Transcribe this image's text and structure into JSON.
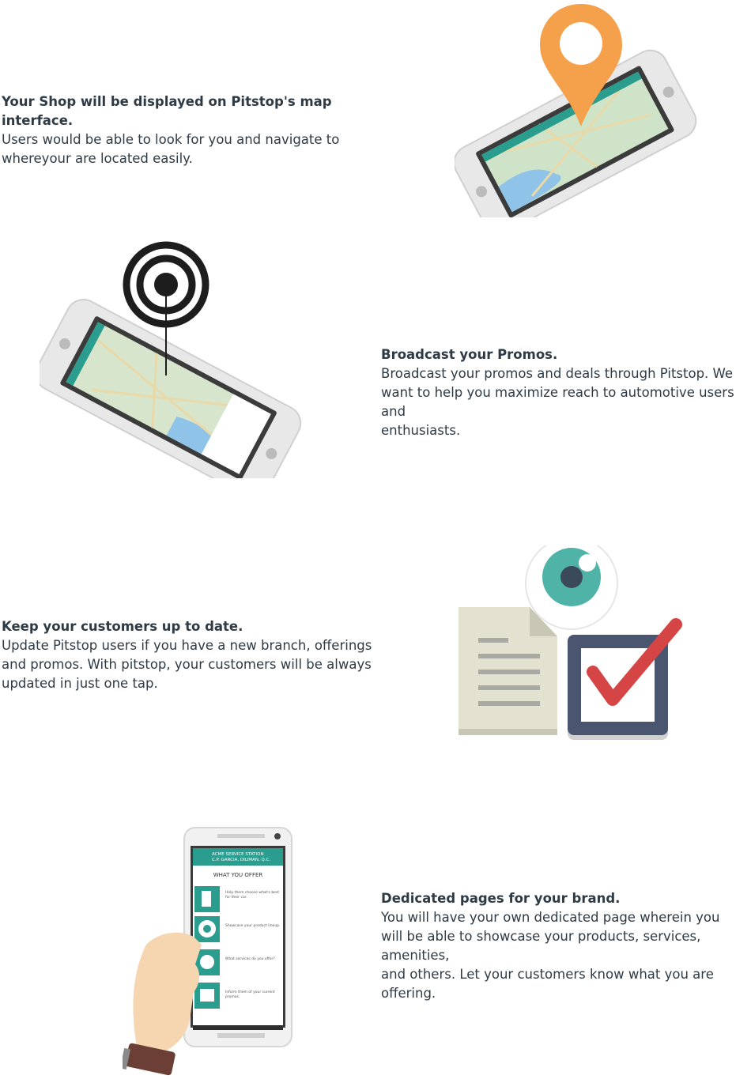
{
  "features": [
    {
      "heading": "Your Shop will be displayed on Pitstop's map interface.",
      "lines": [
        "Users would be able to look for you and navigate to",
        "whereyour are located easily."
      ],
      "illustration": "phone-map-pin-illustration"
    },
    {
      "heading": "Broadcast your Promos.",
      "lines": [
        "Broadcast your promos and deals through Pitstop. We",
        "want to help you maximize reach to automotive users and",
        "enthusiasts."
      ],
      "illustration": "phone-broadcast-signal-illustration"
    },
    {
      "heading": "Keep your customers up to date.",
      "lines": [
        "Update Pitstop users if you have a new branch, offerings",
        "and promos. With pitstop, your customers will be always",
        "updated in just one tap."
      ],
      "illustration": "document-eye-checkbox-illustration"
    },
    {
      "heading": "Dedicated pages for your brand.",
      "lines": [
        "You will have your own dedicated page wherein you",
        "will be able to showcase your products, services, amenities,",
        "and others. Let your customers know what you are",
        "offering."
      ],
      "illustration": "hand-holding-phone-illustration"
    }
  ],
  "phone_screen": {
    "shop_name": "ACME SERVICE STATION",
    "shop_address": "C.P. GARCIA, DILIMAN, Q.C.",
    "section_title": "WHAT YOU OFFER",
    "items": [
      "Help them choose what's best for their car.",
      "Showcase your product lineup.",
      "What services do you offer?",
      "Inform them of your current promos."
    ]
  },
  "colors": {
    "text": "#2e3a44",
    "teal": "#2a9d8f",
    "pin_orange": "#f5a04a",
    "check_red": "#d64545",
    "navy": "#4a5670",
    "paper": "#e3e1d0"
  }
}
